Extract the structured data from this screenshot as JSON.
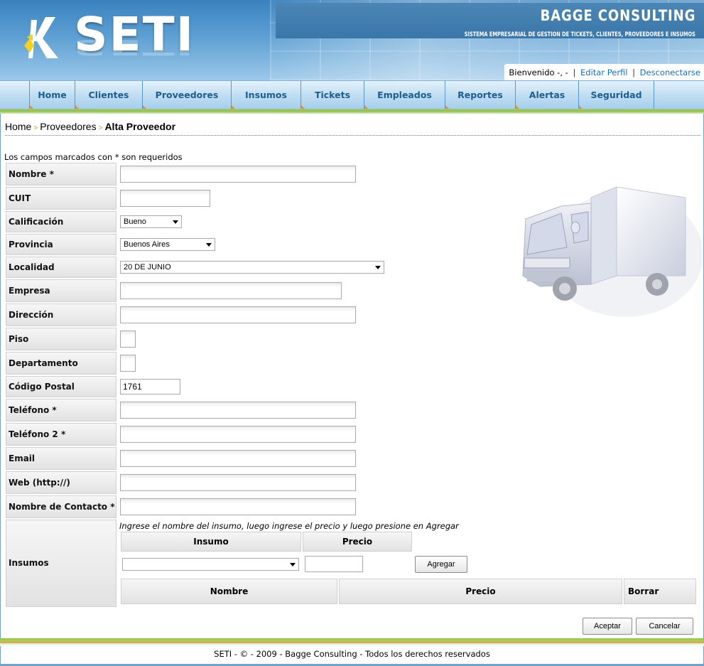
{
  "header": {
    "logo_text": "SETI",
    "brand": "BAGGE CONSULTING",
    "tagline": "SISTEMA EMPRESARIAL DE GESTION DE TICKETS, CLIENTES, PROVEEDORES E INSUMOS",
    "welcome_text": "Bienvenido -, -",
    "edit_profile": "Editar Perfil",
    "logout": "Desconectarse",
    "separator": "|"
  },
  "nav": {
    "items": [
      {
        "label": "Home"
      },
      {
        "label": "Clientes"
      },
      {
        "label": "Proveedores"
      },
      {
        "label": "Insumos"
      },
      {
        "label": "Tickets"
      },
      {
        "label": "Empleados"
      },
      {
        "label": "Reportes"
      },
      {
        "label": "Alertas"
      },
      {
        "label": "Seguridad"
      }
    ]
  },
  "breadcrumb": {
    "home": "Home",
    "section": "Proveedores",
    "current": "Alta Proveedor",
    "separator": ">"
  },
  "form": {
    "required_note": "Los campos marcados con * son requeridos",
    "fields": {
      "nombre": {
        "label": "Nombre *",
        "value": ""
      },
      "cuit": {
        "label": "CUIT",
        "value": ""
      },
      "calificacion": {
        "label": "Calificación",
        "value": "Bueno"
      },
      "provincia": {
        "label": "Provincia",
        "value": "Buenos Aires"
      },
      "localidad": {
        "label": "Localidad",
        "value": "20 DE JUNIO"
      },
      "empresa": {
        "label": "Empresa",
        "value": ""
      },
      "direccion": {
        "label": "Dirección",
        "value": ""
      },
      "piso": {
        "label": "Piso",
        "value": ""
      },
      "departamento": {
        "label": "Departamento",
        "value": ""
      },
      "codigo_postal": {
        "label": "Código Postal",
        "value": "1761"
      },
      "telefono": {
        "label": "Teléfono *",
        "value": ""
      },
      "telefono2": {
        "label": "Teléfono 2 *",
        "value": ""
      },
      "email": {
        "label": "Email",
        "value": ""
      },
      "web": {
        "label": "Web (http://)",
        "value": ""
      },
      "contacto": {
        "label": "Nombre de Contacto *",
        "value": ""
      }
    },
    "insumos": {
      "label": "Insumos",
      "instruction": "Ingrese el nombre del insumo, luego ingrese el precio y luego presione en Agregar",
      "col_insumo": "Insumo",
      "col_precio": "Precio",
      "select_value": "",
      "price_value": "",
      "add_button": "Agregar",
      "table_headers": [
        "Nombre",
        "Precio",
        "Borrar"
      ]
    },
    "accept_button": "Aceptar",
    "cancel_button": "Cancelar"
  },
  "footer": {
    "text": "SETI - © - 2009 - Bagge Consulting - Todos los derechos reservados"
  },
  "colors": {
    "nav_text": "#1e5c90",
    "link": "#1c6fb3",
    "accent_orange": "#e0932b",
    "accent_green": "#8fbf3f"
  }
}
